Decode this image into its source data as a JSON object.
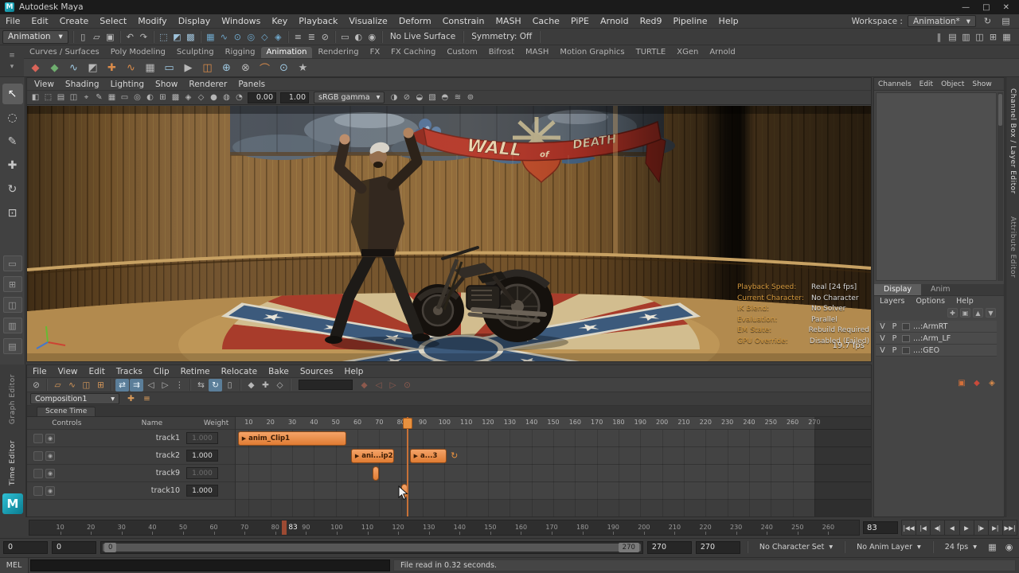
{
  "titlebar": {
    "app_title": "Autodesk Maya",
    "minimize_glyph": "—",
    "maximize_glyph": "□",
    "close_glyph": "✕"
  },
  "menubar": {
    "items": [
      "File",
      "Edit",
      "Create",
      "Select",
      "Modify",
      "Display",
      "Windows",
      "Key",
      "Playback",
      "Visualize",
      "Deform",
      "Constrain",
      "MASH",
      "Cache",
      "PiPE",
      "Arnold",
      "Red9",
      "Pipeline",
      "Help"
    ],
    "workspace_label": "Workspace :",
    "workspace_value": "Animation*",
    "arrow": "▾"
  },
  "statusline": {
    "mode": "Animation",
    "items": [
      {
        "type": "sep"
      },
      {
        "type": "icon",
        "name": "new-scene-icon",
        "glyph": "▯"
      },
      {
        "type": "icon",
        "name": "open-scene-icon",
        "glyph": "▱"
      },
      {
        "type": "icon",
        "name": "save-scene-icon",
        "glyph": "▣"
      },
      {
        "type": "sep"
      },
      {
        "type": "icon",
        "name": "undo-icon",
        "glyph": "↶"
      },
      {
        "type": "icon",
        "name": "redo-icon",
        "glyph": "↷"
      },
      {
        "type": "sep"
      },
      {
        "type": "icon",
        "name": "select-hierarchy-mask-icon",
        "glyph": "⬚",
        "color": "#9fc2da"
      },
      {
        "type": "icon",
        "name": "select-object-mask-icon",
        "glyph": "◩",
        "color": "#9fc2da"
      },
      {
        "type": "icon",
        "name": "select-component-mask-icon",
        "glyph": "▩",
        "color": "#9fc2da"
      },
      {
        "type": "sep"
      },
      {
        "type": "icon",
        "name": "snap-grid-icon",
        "glyph": "▦",
        "color": "#6fa8cc"
      },
      {
        "type": "icon",
        "name": "snap-curve-icon",
        "glyph": "∿",
        "color": "#6fa8cc"
      },
      {
        "type": "icon",
        "name": "snap-point-icon",
        "glyph": "⊙",
        "color": "#6fa8cc"
      },
      {
        "type": "icon",
        "name": "snap-projected-center-icon",
        "glyph": "◎",
        "color": "#6fa8cc"
      },
      {
        "type": "icon",
        "name": "snap-view-plane-icon",
        "glyph": "◇",
        "color": "#6fa8cc"
      },
      {
        "type": "icon",
        "name": "make-live-icon",
        "glyph": "◈",
        "color": "#6fa8cc"
      },
      {
        "type": "sep"
      },
      {
        "type": "icon",
        "name": "input-connections-icon",
        "glyph": "≡"
      },
      {
        "type": "icon",
        "name": "output-connections-icon",
        "glyph": "≣"
      },
      {
        "type": "icon",
        "name": "construction-history-icon",
        "glyph": "⊘"
      },
      {
        "type": "sep"
      },
      {
        "type": "icon",
        "name": "render-icon",
        "glyph": "▭"
      },
      {
        "type": "icon",
        "name": "ipr-render-icon",
        "glyph": "◐"
      },
      {
        "type": "icon",
        "name": "render-settings-icon",
        "glyph": "◉"
      },
      {
        "type": "sep"
      },
      {
        "type": "text",
        "name": "live-surface-status",
        "text": "No Live Surface"
      },
      {
        "type": "sep"
      },
      {
        "type": "text",
        "name": "symmetry-status",
        "text": "Symmetry: Off"
      },
      {
        "type": "sep"
      }
    ],
    "right_icons": [
      {
        "name": "pause-evaluation-icon",
        "glyph": "‖"
      },
      {
        "name": "sidebar-attribute-editor-icon",
        "glyph": "▤"
      },
      {
        "name": "sidebar-tool-settings-icon",
        "glyph": "▥"
      },
      {
        "name": "sidebar-channel-box-icon",
        "glyph": "◫"
      },
      {
        "name": "modeling-toolkit-icon",
        "glyph": "⊞"
      },
      {
        "name": "grid-toggle-icon",
        "glyph": "▦"
      }
    ]
  },
  "shelf": {
    "tabs": [
      "Curves / Surfaces",
      "Poly Modeling",
      "Sculpting",
      "Rigging",
      "Animation",
      "Rendering",
      "FX",
      "FX Caching",
      "Custom",
      "Bifrost",
      "MASH",
      "Motion Graphics",
      "TURTLE",
      "XGen",
      "Arnold"
    ],
    "active_tab": "Animation",
    "menu_icon": "≡",
    "config_icon": "▾",
    "icons": [
      {
        "name": "set-key-icon",
        "glyph": "◆",
        "color": "#d96459"
      },
      {
        "name": "set-breakdown-icon",
        "glyph": "◆",
        "color": "#6fae6f"
      },
      {
        "name": "motion-trail-icon",
        "glyph": "∿",
        "color": "#9ec7e0"
      },
      {
        "name": "ghost-icon",
        "glyph": "◩",
        "color": "#b8b8b8"
      },
      {
        "name": "add-keyframe-icon",
        "glyph": "✚",
        "color": "#d98b4a"
      },
      {
        "name": "graph-editor-icon",
        "glyph": "∿",
        "color": "#d98b4a"
      },
      {
        "name": "dope-sheet-icon",
        "glyph": "▦",
        "color": "#b8b8b8"
      },
      {
        "name": "time-editor-icon",
        "glyph": "▭",
        "color": "#9ec7e0"
      },
      {
        "name": "playblast-icon",
        "glyph": "▶",
        "color": "#b8b8b8"
      },
      {
        "name": "anim-snapshot-icon",
        "glyph": "◫",
        "color": "#d98b4a"
      },
      {
        "name": "bake-simulation-icon",
        "glyph": "⊕",
        "color": "#9ec7e0"
      },
      {
        "name": "constraint-icon",
        "glyph": "⊗",
        "color": "#b8b8b8"
      },
      {
        "name": "ik-handle-icon",
        "glyph": "⌒",
        "color": "#d98b4a"
      },
      {
        "name": "joint-icon",
        "glyph": "⊙",
        "color": "#9ec7e0"
      },
      {
        "name": "human-ik-icon",
        "glyph": "★",
        "color": "#b8b8b8"
      }
    ]
  },
  "toolbox": {
    "tools": [
      {
        "name": "select-tool",
        "glyph": "↖",
        "active": true
      },
      {
        "name": "lasso-select-tool",
        "glyph": "◌"
      },
      {
        "name": "paint-select-tool",
        "glyph": "✎"
      },
      {
        "name": "move-tool",
        "glyph": "✚"
      },
      {
        "name": "rotate-tool",
        "glyph": "↻"
      },
      {
        "name": "scale-tool",
        "glyph": "⊡"
      }
    ],
    "layouts": [
      {
        "name": "layout-single-pane",
        "glyph": "▭"
      },
      {
        "name": "layout-four-view",
        "glyph": "⊞"
      },
      {
        "name": "layout-two-pane",
        "glyph": "◫"
      },
      {
        "name": "layout-persp-outliner",
        "glyph": "▥"
      },
      {
        "name": "layout-custom",
        "glyph": "▤"
      }
    ]
  },
  "viewport": {
    "menus": [
      "View",
      "Shading",
      "Lighting",
      "Show",
      "Renderer",
      "Panels"
    ],
    "toolbar_icons_a": [
      {
        "name": "select-camera-icon",
        "glyph": "◧"
      },
      {
        "name": "camera-attributes-icon",
        "glyph": "⬚"
      },
      {
        "name": "bookmarks-icon",
        "glyph": "▤"
      },
      {
        "name": "image-plane-icon",
        "glyph": "◫"
      },
      {
        "name": "two-d-pan-zoom-icon",
        "glyph": "⌖"
      },
      {
        "name": "grease-pencil-icon",
        "glyph": "✎"
      },
      {
        "name": "grid-icon",
        "glyph": "▦"
      },
      {
        "name": "film-gate-icon",
        "glyph": "▭"
      },
      {
        "name": "resolution-gate-icon",
        "glyph": "◎"
      },
      {
        "name": "gate-mask-icon",
        "glyph": "◐"
      },
      {
        "name": "field-chart-icon",
        "glyph": "⊞"
      },
      {
        "name": "safe-action-icon",
        "glyph": "▩"
      },
      {
        "name": "safe-title-icon",
        "glyph": "◈"
      },
      {
        "name": "wireframe-icon",
        "glyph": "◇"
      },
      {
        "name": "shaded-icon",
        "glyph": "●"
      },
      {
        "name": "textured-icon",
        "glyph": "◍"
      },
      {
        "name": "lights-icon",
        "glyph": "◔"
      }
    ],
    "exposure": "0.00",
    "gamma": "1.00",
    "colorspace": "sRGB gamma",
    "toolbar_icons_b": [
      {
        "name": "xray-icon",
        "glyph": "◑"
      },
      {
        "name": "xray-joints-icon",
        "glyph": "⊘"
      },
      {
        "name": "isolate-select-icon",
        "glyph": "◒"
      },
      {
        "name": "shadows-icon",
        "glyph": "▧"
      },
      {
        "name": "ssao-icon",
        "glyph": "◓"
      },
      {
        "name": "motion-blur-icon",
        "glyph": "≋"
      },
      {
        "name": "anti-aliasing-icon",
        "glyph": "⊚"
      }
    ],
    "banner": {
      "word1": "WALL",
      "word2": "of",
      "word3": "DEATH"
    },
    "hud": {
      "rows": [
        {
          "label": "Playback Speed:",
          "value": "Real [24 fps]"
        },
        {
          "label": "Current Character:",
          "value": "No Character"
        },
        {
          "label": "IK Blend:",
          "value": "No Solver"
        },
        {
          "label": "Evaluation:",
          "value": "Parallel"
        },
        {
          "label": "EM State:",
          "value": "Rebuild Required"
        },
        {
          "label": "GPU Override:",
          "value": "Disabled (Failed)"
        }
      ],
      "fps": "19.7 fps"
    }
  },
  "channel_box": {
    "tabs": [
      "Channels",
      "Edit",
      "Object",
      "Show"
    ],
    "side_tabs": [
      {
        "label": "Channel Box / Layer Editor",
        "active": true
      },
      {
        "label": "Attribute Editor",
        "active": false
      }
    ],
    "panel_icons": [
      {
        "name": "panel-icon-orange",
        "glyph": "▣",
        "color": "#d4703a"
      },
      {
        "name": "panel-icon-red",
        "glyph": "◆",
        "color": "#c84a3a"
      },
      {
        "name": "panel-icon-amber",
        "glyph": "◈",
        "color": "#d98b4a"
      }
    ],
    "layer_editor": {
      "tabs": [
        {
          "label": "Display",
          "active": true
        },
        {
          "label": "Anim",
          "active": false
        }
      ],
      "menus": [
        "Layers",
        "Options",
        "Help"
      ],
      "toolbar_icons": [
        {
          "name": "new-empty-layer-icon",
          "glyph": "✚"
        },
        {
          "name": "new-layer-from-selected-icon",
          "glyph": "▣"
        },
        {
          "name": "move-layer-up-icon",
          "glyph": "▲"
        },
        {
          "name": "move-layer-down-icon",
          "glyph": "▼"
        }
      ],
      "layers": [
        {
          "visibility": "V",
          "playback": "P",
          "name": "...:ArmRT"
        },
        {
          "visibility": "V",
          "playback": "P",
          "name": "...:Arm_LF"
        },
        {
          "visibility": "V",
          "playback": "P",
          "name": "...:GEO"
        }
      ]
    }
  },
  "time_editor": {
    "side_tabs": [
      {
        "label": "Graph Editor",
        "active": false
      },
      {
        "label": "Time Editor",
        "active": true
      }
    ],
    "menus": [
      "File",
      "View",
      "Edit",
      "Tracks",
      "Clip",
      "Retime",
      "Relocate",
      "Bake",
      "Sources",
      "Help"
    ],
    "toolbar": [
      {
        "type": "icon",
        "name": "mute-track-icon",
        "glyph": "⊘"
      },
      {
        "type": "sep"
      },
      {
        "type": "icon",
        "name": "add-anim-clip-icon",
        "glyph": "▱",
        "color": "#d99a5a"
      },
      {
        "type": "icon",
        "name": "add-audio-clip-icon",
        "glyph": "∿",
        "color": "#d99a5a"
      },
      {
        "type": "icon",
        "name": "add-pose-clip-icon",
        "glyph": "◫",
        "color": "#d99a5a"
      },
      {
        "type": "icon",
        "name": "create-group-icon",
        "glyph": "⊞",
        "color": "#d99a5a"
      },
      {
        "type": "sep"
      },
      {
        "type": "icon",
        "name": "move-mode-icon",
        "glyph": "⇄",
        "active": true
      },
      {
        "type": "icon",
        "name": "ripple-mode-icon",
        "glyph": "⇉",
        "active": true
      },
      {
        "type": "icon",
        "name": "trim-start-icon",
        "glyph": "◁"
      },
      {
        "type": "icon",
        "name": "trim-end-icon",
        "glyph": "▷"
      },
      {
        "type": "icon",
        "name": "razor-icon",
        "glyph": "⋮"
      },
      {
        "type": "sep"
      },
      {
        "type": "icon",
        "name": "scale-clip-icon",
        "glyph": "⇆"
      },
      {
        "type": "icon",
        "name": "loop-clip-icon",
        "glyph": "↻",
        "active": true
      },
      {
        "type": "icon",
        "name": "hold-clip-icon",
        "glyph": "▯"
      },
      {
        "type": "sep"
      },
      {
        "type": "icon",
        "name": "key-clip-icon",
        "glyph": "◆"
      },
      {
        "type": "icon",
        "name": "add-key-icon",
        "glyph": "✚"
      },
      {
        "type": "icon",
        "name": "mute-key-icon",
        "glyph": "◇"
      },
      {
        "type": "sep"
      },
      {
        "type": "field",
        "name": "clip-filter-field"
      },
      {
        "type": "icon",
        "name": "ghost-clip-icon",
        "glyph": "◆",
        "dim": true
      },
      {
        "type": "icon",
        "name": "ghost-previous-icon",
        "glyph": "◁",
        "dim": true
      },
      {
        "type": "icon",
        "name": "ghost-next-icon",
        "glyph": "▷",
        "dim": true
      },
      {
        "type": "icon",
        "name": "ghost-settings-icon",
        "glyph": "⊙",
        "dim": true
      }
    ],
    "composition": "Composition1",
    "comp_icons": [
      {
        "name": "new-composition-icon",
        "glyph": "✚",
        "color": "#d99a5a"
      },
      {
        "name": "composition-list-icon",
        "glyph": "≡",
        "color": "#d99a5a"
      }
    ],
    "scene_tab": "Scene Time",
    "columns": {
      "controls": "Controls",
      "name": "Name",
      "weight": "Weight"
    },
    "axis": {
      "frame_start": 4,
      "frame_end": 296,
      "tick_first": 10,
      "tick_last": 270,
      "tick_step": 10,
      "range_end": 270
    },
    "playhead_frame": 83,
    "track_toggle_icons": [
      {
        "name": "track-mute-toggle",
        "glyph": ""
      },
      {
        "name": "track-solo-toggle",
        "glyph": "◉"
      }
    ],
    "tracks": [
      {
        "name": "track1",
        "weight": "1.000",
        "weight_active": false
      },
      {
        "name": "track2",
        "weight": "1.000",
        "weight_active": true
      },
      {
        "name": "track9",
        "weight": "1.000",
        "weight_active": false
      },
      {
        "name": "track10",
        "weight": "1.000",
        "weight_active": true
      }
    ],
    "clips": [
      {
        "track": 0,
        "start": 5,
        "end": 55,
        "label": "anim_Clip1",
        "play": true
      },
      {
        "track": 1,
        "start": 57,
        "end": 77,
        "label": "ani...ip2",
        "play": true
      },
      {
        "track": 1,
        "start": 84,
        "end": 101,
        "label": "a...3",
        "play": true,
        "loop": true
      },
      {
        "track": 2,
        "start": 67,
        "end": 70,
        "label": ""
      },
      {
        "track": 3,
        "start": 80,
        "end": 83,
        "label": ""
      }
    ],
    "loop_glyph": "↻"
  },
  "time_slider": {
    "min": 0,
    "max": 270,
    "tick_step": 10,
    "label_first": 10,
    "label_last": 260,
    "current_frame": 83,
    "current_label": "83",
    "time_field_value": "83"
  },
  "transport": {
    "buttons": [
      {
        "name": "go-to-start-button",
        "glyph": "|◀◀"
      },
      {
        "name": "step-back-frame-button",
        "glyph": "|◀"
      },
      {
        "name": "step-back-key-button",
        "glyph": "◀|"
      },
      {
        "name": "play-backwards-button",
        "glyph": "◀"
      },
      {
        "name": "play-button",
        "glyph": "▶"
      },
      {
        "name": "step-forward-key-button",
        "glyph": "|▶"
      },
      {
        "name": "step-forward-frame-button",
        "glyph": "▶|"
      },
      {
        "name": "go-to-end-button",
        "glyph": "▶▶|"
      }
    ]
  },
  "range_bar": {
    "anim_start": "0",
    "play_start": "0",
    "handle_start": "0",
    "handle_end": "270",
    "play_end": "270",
    "anim_end": "270",
    "character_set": "No Character Set",
    "anim_layer": "No Anim Layer",
    "fps": "24 fps",
    "arrow": "▾",
    "icons": [
      {
        "name": "render-view-icon",
        "glyph": "▦"
      },
      {
        "name": "anim-prefs-icon",
        "glyph": "◉"
      }
    ]
  },
  "command_line": {
    "label": "MEL",
    "input_value": "",
    "status": "File read in  0.32 seconds."
  }
}
